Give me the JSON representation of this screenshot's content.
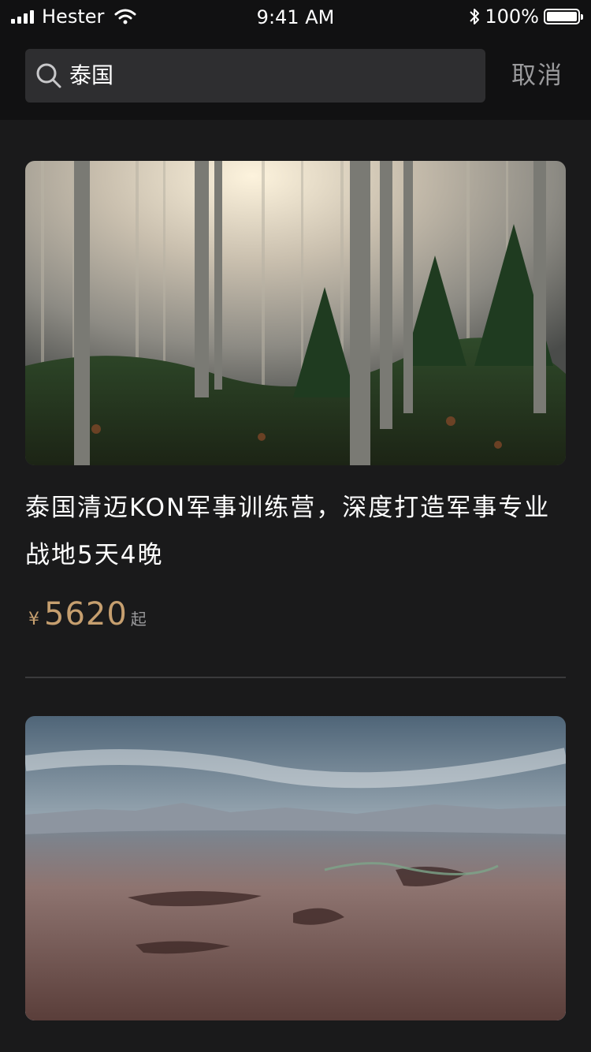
{
  "status_bar": {
    "carrier": "Hester",
    "time": "9:41 AM",
    "battery": "100%",
    "icons": [
      "signal-icon",
      "wifi-icon",
      "bluetooth-icon",
      "battery-icon"
    ]
  },
  "search": {
    "value": "泰国",
    "placeholder": "",
    "cancel_label": "取消"
  },
  "results": [
    {
      "title": "泰国清迈KON军事训练营，深度打造军事专业战地5天4晚",
      "currency": "¥",
      "price": "5620",
      "price_suffix": "起",
      "image": "forest-photo"
    },
    {
      "title": "",
      "image": "canyon-photo"
    }
  ],
  "colors": {
    "background": "#1a1a1b",
    "header": "#111112",
    "search_box": "#2e2e30",
    "price": "#c69f6f",
    "muted": "#9a9a9c"
  }
}
